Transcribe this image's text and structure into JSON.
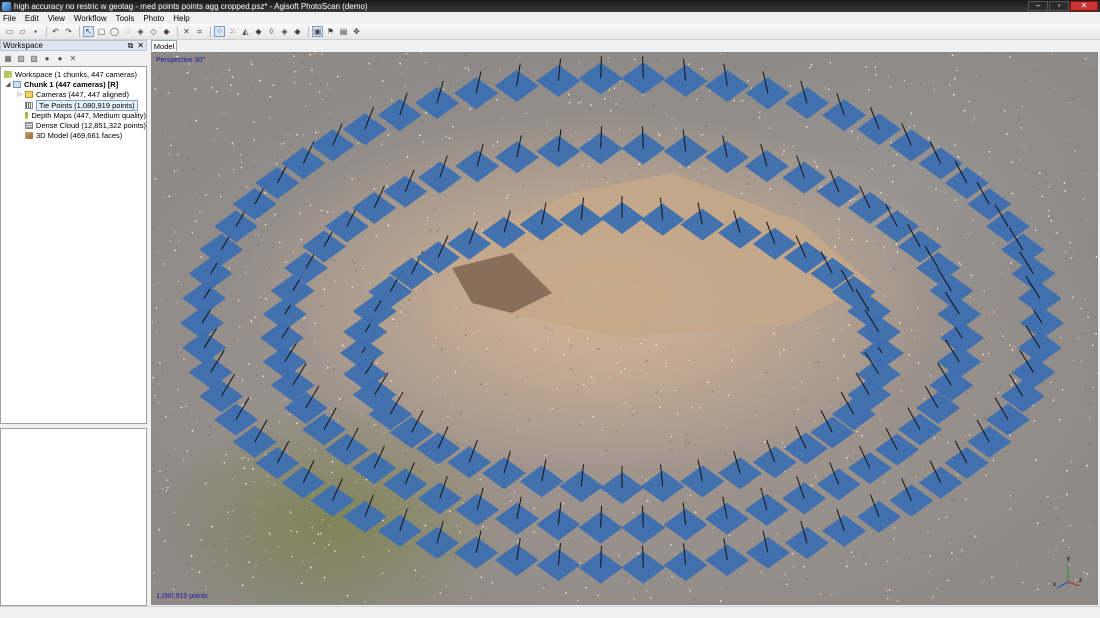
{
  "window": {
    "title": "high accuracy no restric w geotag - med points points agg cropped.psz* - Agisoft PhotoScan (demo)"
  },
  "menu": [
    "File",
    "Edit",
    "View",
    "Workflow",
    "Tools",
    "Photo",
    "Help"
  ],
  "workspace": {
    "header": "Workspace",
    "tree": [
      {
        "label": "Workspace (1 chunks, 447 cameras)",
        "level": 0,
        "icon": "workspace-icon"
      },
      {
        "label": "Chunk 1 (447 cameras) [R]",
        "level": 1,
        "icon": "chunk-icon",
        "bold": true
      },
      {
        "label": "Cameras (447, 447 aligned)",
        "level": 2,
        "icon": "cameras-folder-icon"
      },
      {
        "label": "Tie Points (1,080,919 points)",
        "level": 2,
        "icon": "tie-points-icon",
        "selected": true
      },
      {
        "label": "Depth Maps (447, Medium quality)",
        "level": 2,
        "icon": "depth-maps-icon"
      },
      {
        "label": "Dense Cloud (12,851,322 points)",
        "level": 2,
        "icon": "dense-cloud-icon"
      },
      {
        "label": "3D Model (469,661 faces)",
        "level": 2,
        "icon": "model-icon"
      }
    ]
  },
  "model_view": {
    "tab": "Model",
    "projection": "Perspective 30°",
    "point_count": "1,080,919 points",
    "axes": [
      "x",
      "y",
      "z"
    ]
  }
}
